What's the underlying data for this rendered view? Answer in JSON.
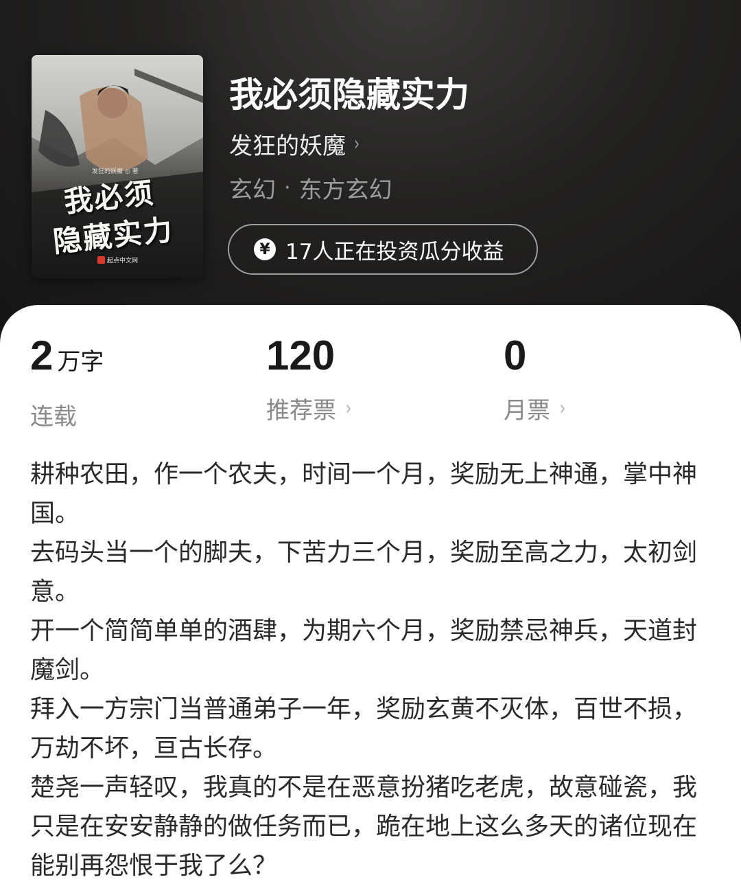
{
  "book": {
    "title": "我必须隐藏实力",
    "author": "发狂的妖魔",
    "genre_main": "玄幻",
    "genre_separator": "·",
    "genre_sub": "东方玄幻",
    "invest_icon": "¥",
    "invest_text": "17人正在投资瓜分收益"
  },
  "cover": {
    "title_line1": "我必须",
    "title_line2": "隐藏实力",
    "author_small": "发狂的妖魔 ◎ 著",
    "publisher": "起点中文网"
  },
  "stats": {
    "words_value": "2",
    "words_unit": "万字",
    "words_label": "连载",
    "rec_value": "120",
    "rec_label": "推荐票",
    "month_value": "0",
    "month_label": "月票",
    "chevron": "›"
  },
  "description": [
    "耕种农田，作一个农夫，时间一个月，奖励无上神通，掌中神国。",
    "去码头当一个的脚夫，下苦力三个月，奖励至高之力，太初剑意。",
    "开一个简简单单的酒肆，为期六个月，奖励禁忌神兵，天道封魔剑。",
    "拜入一方宗门当普通弟子一年，奖励玄黄不灭体，百世不损，万劫不坏，亘古长存。",
    "楚尧一声轻叹，我真的不是在恶意扮猪吃老虎，故意碰瓷，我只是在安安静静的做任务而已，跪在地上这么多天的诸位现在能别再怨恨于我了么？"
  ]
}
